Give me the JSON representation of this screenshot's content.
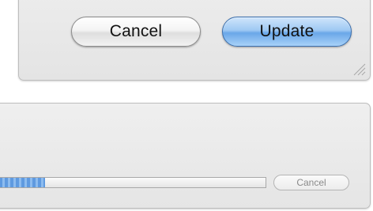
{
  "dialog": {
    "cancel_label": "Cancel",
    "update_label": "Update",
    "update_accent_color": "#6aa7e8",
    "resize_grip_icon": "resize-grip-icon"
  },
  "progress": {
    "fraction": 0.19,
    "fill_color": "#5f9ae0",
    "cancel_label": "Cancel",
    "cancel_enabled": false
  }
}
